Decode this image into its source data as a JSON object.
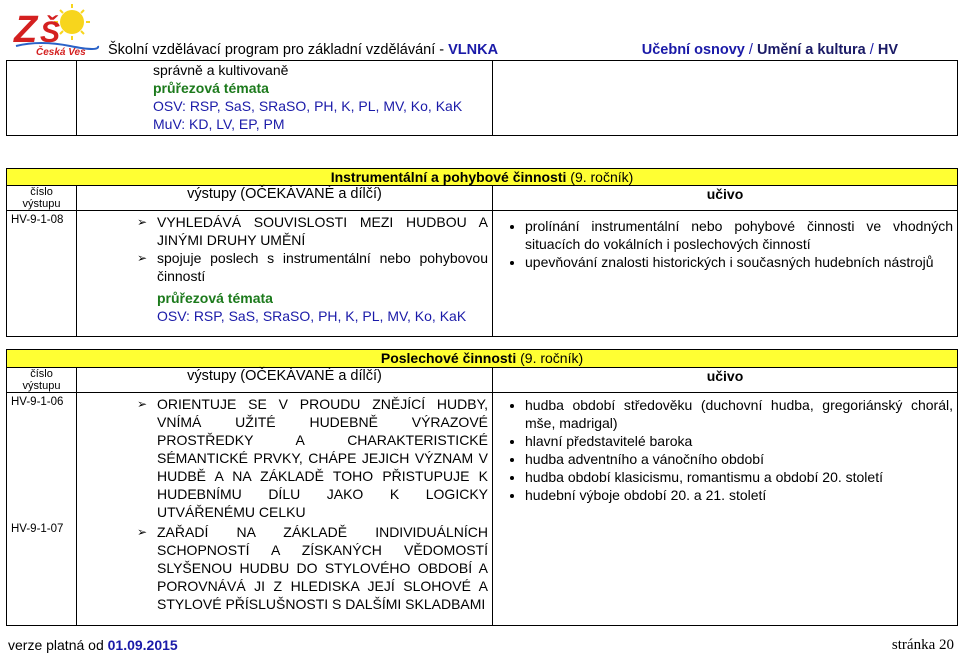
{
  "header": {
    "logo_text": "ZŠ Česká Ves",
    "program_prefix": "Školní vzdělávací program pro základní vzdělávání - ",
    "program_name": "VLNKA",
    "section_a": "Učební osnovy",
    "sep": " / ",
    "section_b": "Umění a kultura",
    "sep2": " / ",
    "section_c": "HV"
  },
  "top_block": {
    "line1": "správně a kultivovaně",
    "pt_label": "průřezová témata",
    "osv": "OSV: RSP, SaS, SRaSO, PH, K, PL, MV, Ko, KaK",
    "muv": "MuV: KD, LV, EP, PM"
  },
  "section1": {
    "title_bold": "Instrumentální a pohybové činnosti",
    "title_rest": " (9. ročník)",
    "col_code": "číslo výstupu",
    "col_outputs": "výstupy (OČEKÁVANÉ a dílčí)",
    "col_content": "učivo",
    "code": "HV-9-1-08",
    "outputs": [
      "VYHLEDÁVÁ SOUVISLOSTI MEZI HUDBOU A JINÝMI DRUHY UMĚNÍ",
      "spojuje poslech s instrumentální nebo pohybovou činností"
    ],
    "pt_label": "průřezová témata",
    "osv": "OSV: RSP, SaS, SRaSO, PH, K, PL, MV, Ko, KaK",
    "content": [
      "prolínání instrumentální nebo pohybové činnosti ve vhodných situacích do vokálních i poslechových činností",
      "upevňování znalosti historických i současných hudebních nástrojů"
    ]
  },
  "section2": {
    "title_bold": "Poslechové činnosti",
    "title_rest": " (9. ročník)",
    "col_code": "číslo výstupu",
    "col_outputs": "výstupy (OČEKÁVANÉ a dílčí)",
    "col_content": "učivo",
    "code1": "HV-9-1-06",
    "code2": "HV-9-1-07",
    "outputs": [
      "ORIENTUJE SE V PROUDU ZNĚJÍCÍ HUDBY, VNÍMÁ UŽITÉ HUDEBNĚ VÝRAZOVÉ PROSTŘEDKY A CHARAKTERISTICKÉ SÉMANTICKÉ PRVKY, CHÁPE JEJICH VÝZNAM V HUDBĚ A NA ZÁKLADĚ TOHO PŘISTUPUJE K HUDEBNÍMU DÍLU JAKO K LOGICKY UTVÁŘENÉMU CELKU",
      "ZAŘADÍ NA ZÁKLADĚ INDIVIDUÁLNÍCH SCHOPNOSTÍ A ZÍSKANÝCH VĚDOMOSTÍ SLYŠENOU HUDBU DO STYLOVÉHO OBDOBÍ A POROVNÁVÁ JI Z HLEDISKA JEJÍ SLOHOVÉ A STYLOVÉ PŘÍSLUŠNOSTI S DALŠÍMI SKLADBAMI"
    ],
    "content": [
      "hudba období středověku (duchovní hudba, gregoriánský chorál, mše, madrigal)",
      "hlavní představitelé baroka",
      "hudba adventního a vánočního období",
      "hudba období klasicismu, romantismu a období 20. století",
      "hudební výboje období 20. a 21. století"
    ]
  },
  "footer": {
    "version_prefix": "verze platná od ",
    "version_date": "01.09.2015",
    "page": "stránka 20"
  },
  "colors": {
    "accent_blue": "#1a1aa8",
    "green": "#1c7a1c",
    "yellow": "#ffff33",
    "logo_red": "#d42020"
  }
}
